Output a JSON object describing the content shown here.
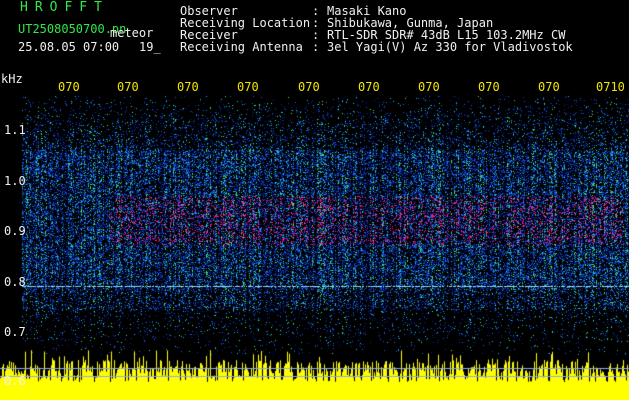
{
  "header": {
    "app_title": "HROFFT",
    "file_name": "UT2508050700.pn",
    "category": "meteor",
    "datetime": "25.08.05 07:00",
    "count": "19_",
    "info_rows": [
      {
        "label": "Observer",
        "value": "Masaki Kano"
      },
      {
        "label": "Receiving Location",
        "value": "Shibukawa, Gunma, Japan"
      },
      {
        "label": "Receiver",
        "value": "RTL-SDR SDR# 43dB L15 103.2MHz CW"
      },
      {
        "label": "Receiving Antenna",
        "value": "3el Yagi(V) Az 330 for Vladivostok"
      }
    ]
  },
  "plot": {
    "y_unit": "kHz",
    "y_ticks": [
      "1.1",
      "1.0",
      "0.9",
      "0.8",
      "0.7",
      "0.6"
    ],
    "time_labels": [
      "070",
      "070",
      "070",
      "070",
      "070",
      "070",
      "070",
      "070",
      "070",
      "0710"
    ],
    "colors": {
      "text": "#f0f0f0",
      "header_green": "#33e64a",
      "labels_yellow": "#f2e600",
      "echo_magenta": "#ff1a8c",
      "background_blue": "#0a2aa8"
    }
  }
}
